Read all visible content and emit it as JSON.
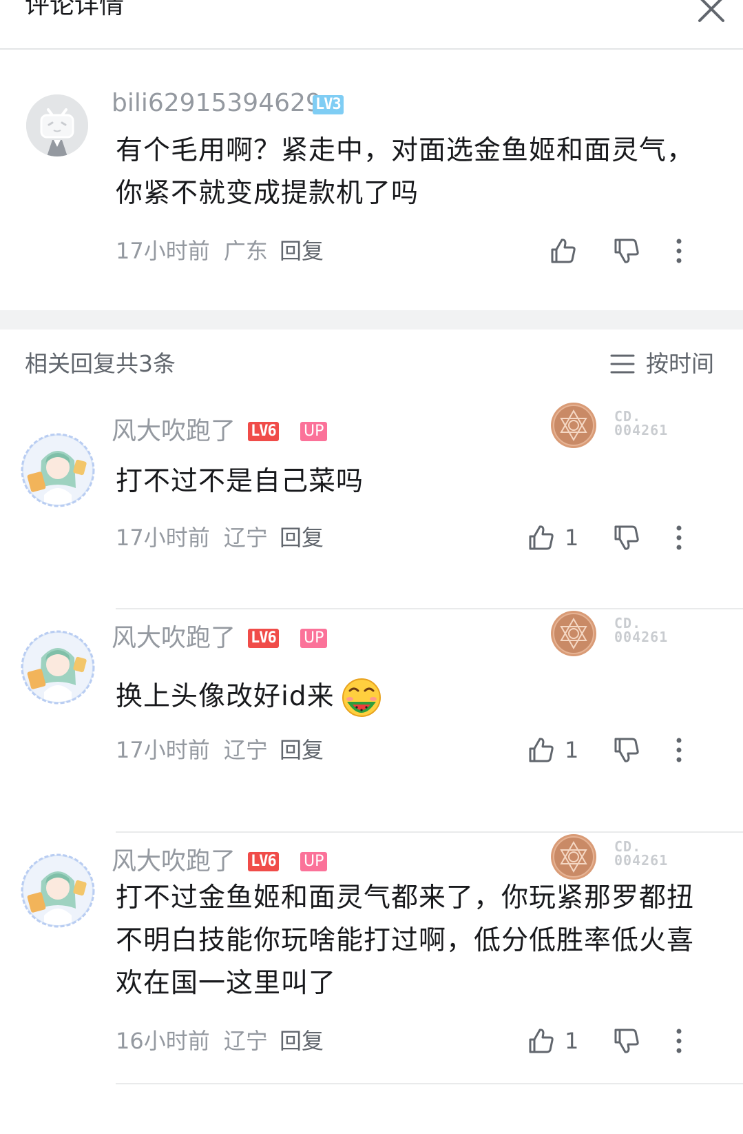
{
  "header": {
    "title": "评论详情",
    "close_icon": "close-icon"
  },
  "main_comment": {
    "username": "bili62915394629",
    "level": "LV3",
    "text": "有个毛用啊？紧走中，对面选金鱼姬和面灵气，你紧不就变成提款机了吗",
    "time": "17小时前",
    "location": "广东",
    "reply_label": "回复"
  },
  "replies_header": {
    "count_text": "相关回复共3条",
    "sort_label": "按时间"
  },
  "replies": [
    {
      "username": "风大吹跑了",
      "level": "LV6",
      "up": "UP",
      "medal_text_1": "CD.",
      "medal_text_2": "004261",
      "text": "打不过不是自己菜吗",
      "time": "17小时前",
      "location": "辽宁",
      "reply_label": "回复",
      "likes": "1"
    },
    {
      "username": "风大吹跑了",
      "level": "LV6",
      "up": "UP",
      "medal_text_1": "CD.",
      "medal_text_2": "004261",
      "text": "换上头像改好id来",
      "emoji": "watermelon-face-emoji",
      "time": "17小时前",
      "location": "辽宁",
      "reply_label": "回复",
      "likes": "1"
    },
    {
      "username": "风大吹跑了",
      "level": "LV6",
      "up": "UP",
      "medal_text_1": "CD.",
      "medal_text_2": "004261",
      "text": "打不过金鱼姬和面灵气都来了，你玩紧那罗都扭不明白技能你玩啥能打过啊，低分低胜率低火喜欢在国一这里叫了",
      "time": "16小时前",
      "location": "辽宁",
      "reply_label": "回复",
      "likes": "1"
    }
  ],
  "colors": {
    "text_primary": "#18191c",
    "text_secondary": "#9499a0",
    "level3": "#7fcdf4",
    "level6": "#f04c49",
    "up_pink": "#fb7299",
    "medal_bronze": "#c98a66"
  }
}
